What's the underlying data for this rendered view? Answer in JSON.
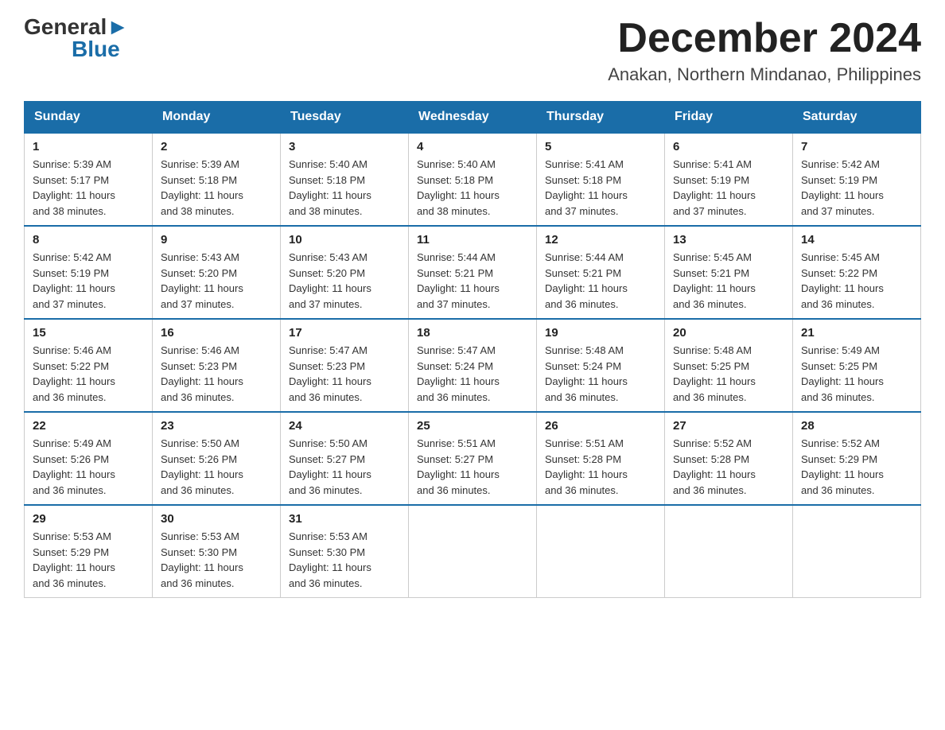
{
  "header": {
    "logo_general": "General",
    "logo_blue": "Blue",
    "month_title": "December 2024",
    "location": "Anakan, Northern Mindanao, Philippines"
  },
  "weekdays": [
    "Sunday",
    "Monday",
    "Tuesday",
    "Wednesday",
    "Thursday",
    "Friday",
    "Saturday"
  ],
  "weeks": [
    [
      {
        "day": "1",
        "sunrise": "5:39 AM",
        "sunset": "5:17 PM",
        "daylight": "11 hours and 38 minutes."
      },
      {
        "day": "2",
        "sunrise": "5:39 AM",
        "sunset": "5:18 PM",
        "daylight": "11 hours and 38 minutes."
      },
      {
        "day": "3",
        "sunrise": "5:40 AM",
        "sunset": "5:18 PM",
        "daylight": "11 hours and 38 minutes."
      },
      {
        "day": "4",
        "sunrise": "5:40 AM",
        "sunset": "5:18 PM",
        "daylight": "11 hours and 38 minutes."
      },
      {
        "day": "5",
        "sunrise": "5:41 AM",
        "sunset": "5:18 PM",
        "daylight": "11 hours and 37 minutes."
      },
      {
        "day": "6",
        "sunrise": "5:41 AM",
        "sunset": "5:19 PM",
        "daylight": "11 hours and 37 minutes."
      },
      {
        "day": "7",
        "sunrise": "5:42 AM",
        "sunset": "5:19 PM",
        "daylight": "11 hours and 37 minutes."
      }
    ],
    [
      {
        "day": "8",
        "sunrise": "5:42 AM",
        "sunset": "5:19 PM",
        "daylight": "11 hours and 37 minutes."
      },
      {
        "day": "9",
        "sunrise": "5:43 AM",
        "sunset": "5:20 PM",
        "daylight": "11 hours and 37 minutes."
      },
      {
        "day": "10",
        "sunrise": "5:43 AM",
        "sunset": "5:20 PM",
        "daylight": "11 hours and 37 minutes."
      },
      {
        "day": "11",
        "sunrise": "5:44 AM",
        "sunset": "5:21 PM",
        "daylight": "11 hours and 37 minutes."
      },
      {
        "day": "12",
        "sunrise": "5:44 AM",
        "sunset": "5:21 PM",
        "daylight": "11 hours and 36 minutes."
      },
      {
        "day": "13",
        "sunrise": "5:45 AM",
        "sunset": "5:21 PM",
        "daylight": "11 hours and 36 minutes."
      },
      {
        "day": "14",
        "sunrise": "5:45 AM",
        "sunset": "5:22 PM",
        "daylight": "11 hours and 36 minutes."
      }
    ],
    [
      {
        "day": "15",
        "sunrise": "5:46 AM",
        "sunset": "5:22 PM",
        "daylight": "11 hours and 36 minutes."
      },
      {
        "day": "16",
        "sunrise": "5:46 AM",
        "sunset": "5:23 PM",
        "daylight": "11 hours and 36 minutes."
      },
      {
        "day": "17",
        "sunrise": "5:47 AM",
        "sunset": "5:23 PM",
        "daylight": "11 hours and 36 minutes."
      },
      {
        "day": "18",
        "sunrise": "5:47 AM",
        "sunset": "5:24 PM",
        "daylight": "11 hours and 36 minutes."
      },
      {
        "day": "19",
        "sunrise": "5:48 AM",
        "sunset": "5:24 PM",
        "daylight": "11 hours and 36 minutes."
      },
      {
        "day": "20",
        "sunrise": "5:48 AM",
        "sunset": "5:25 PM",
        "daylight": "11 hours and 36 minutes."
      },
      {
        "day": "21",
        "sunrise": "5:49 AM",
        "sunset": "5:25 PM",
        "daylight": "11 hours and 36 minutes."
      }
    ],
    [
      {
        "day": "22",
        "sunrise": "5:49 AM",
        "sunset": "5:26 PM",
        "daylight": "11 hours and 36 minutes."
      },
      {
        "day": "23",
        "sunrise": "5:50 AM",
        "sunset": "5:26 PM",
        "daylight": "11 hours and 36 minutes."
      },
      {
        "day": "24",
        "sunrise": "5:50 AM",
        "sunset": "5:27 PM",
        "daylight": "11 hours and 36 minutes."
      },
      {
        "day": "25",
        "sunrise": "5:51 AM",
        "sunset": "5:27 PM",
        "daylight": "11 hours and 36 minutes."
      },
      {
        "day": "26",
        "sunrise": "5:51 AM",
        "sunset": "5:28 PM",
        "daylight": "11 hours and 36 minutes."
      },
      {
        "day": "27",
        "sunrise": "5:52 AM",
        "sunset": "5:28 PM",
        "daylight": "11 hours and 36 minutes."
      },
      {
        "day": "28",
        "sunrise": "5:52 AM",
        "sunset": "5:29 PM",
        "daylight": "11 hours and 36 minutes."
      }
    ],
    [
      {
        "day": "29",
        "sunrise": "5:53 AM",
        "sunset": "5:29 PM",
        "daylight": "11 hours and 36 minutes."
      },
      {
        "day": "30",
        "sunrise": "5:53 AM",
        "sunset": "5:30 PM",
        "daylight": "11 hours and 36 minutes."
      },
      {
        "day": "31",
        "sunrise": "5:53 AM",
        "sunset": "5:30 PM",
        "daylight": "11 hours and 36 minutes."
      },
      null,
      null,
      null,
      null
    ]
  ],
  "labels": {
    "sunrise": "Sunrise:",
    "sunset": "Sunset:",
    "daylight": "Daylight:"
  }
}
